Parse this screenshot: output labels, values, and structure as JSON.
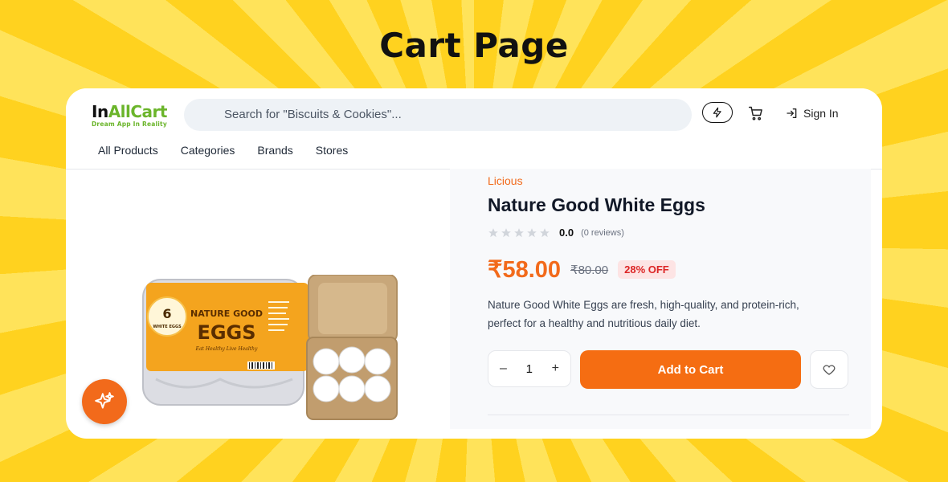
{
  "banner": {
    "title": "Cart Page"
  },
  "header": {
    "logo": {
      "part1": "In",
      "part2": "AllCart",
      "tagline": "Dream App In Reality"
    },
    "search": {
      "placeholder": "Search for \"Biscuits & Cookies\"..."
    },
    "signin_label": "Sign In"
  },
  "nav": {
    "items": [
      "All Products",
      "Categories",
      "Brands",
      "Stores"
    ]
  },
  "product": {
    "brand": "Licious",
    "title": "Nature Good White Eggs",
    "rating": "0.0",
    "reviews": "(0 reviews)",
    "stars_filled": 0,
    "stars_total": 5,
    "price": "₹58.00",
    "old_price": "₹80.00",
    "discount": "28% OFF",
    "description": "Nature Good White Eggs are fresh, high-quality, and protein-rich, perfect for a healthy and nutritious daily diet.",
    "quantity": "1",
    "add_to_cart_label": "Add to Cart",
    "image_text": {
      "count": "6",
      "count_label": "WHITE EGGS",
      "brand": "NATURE GOOD",
      "name": "EGGS",
      "tagline": "Eat Healthy Live Healthy"
    }
  },
  "icons": {
    "flash": "lightning-icon",
    "cart": "cart-icon",
    "signin": "sign-in-icon",
    "wishlist": "heart-icon",
    "assistant": "sparkle-icon"
  },
  "colors": {
    "accent": "#f56d12",
    "brand_green": "#6bb52b",
    "discount_red": "#dc2626",
    "banner_yellow": "#ffd21f"
  }
}
